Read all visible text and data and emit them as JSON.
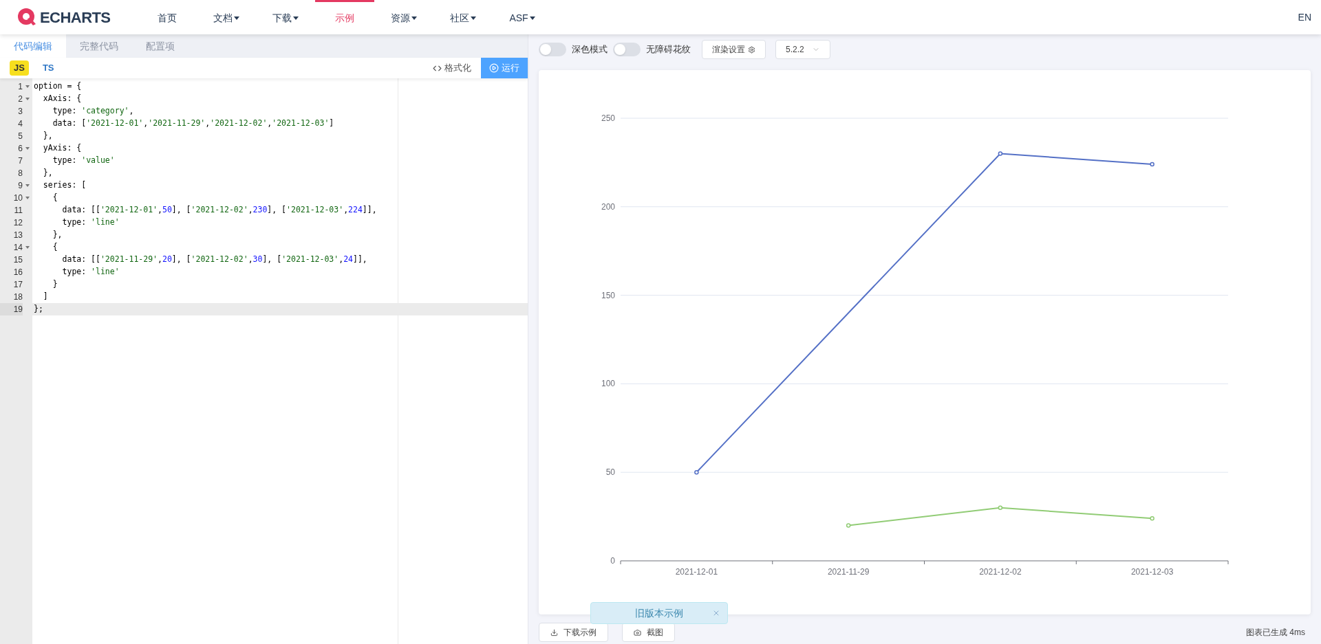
{
  "nav": {
    "logo": "ECHARTS",
    "items": [
      {
        "label": "首页",
        "dropdown": false,
        "selected": false
      },
      {
        "label": "文档",
        "dropdown": true,
        "selected": false
      },
      {
        "label": "下载",
        "dropdown": true,
        "selected": false
      },
      {
        "label": "示例",
        "dropdown": false,
        "selected": true
      },
      {
        "label": "资源",
        "dropdown": true,
        "selected": false
      },
      {
        "label": "社区",
        "dropdown": true,
        "selected": false
      },
      {
        "label": "ASF",
        "dropdown": true,
        "selected": false
      }
    ],
    "language": "EN"
  },
  "editor": {
    "tabs": [
      {
        "label": "代码编辑",
        "selected": true
      },
      {
        "label": "完整代码",
        "selected": false
      },
      {
        "label": "配置项",
        "selected": false
      }
    ],
    "languages": [
      {
        "label": "JS",
        "selected": true
      },
      {
        "label": "TS",
        "selected": false
      }
    ],
    "format_button": "格式化",
    "run_button": "运行",
    "lines": [
      {
        "number": "1",
        "fold": true,
        "current": false,
        "tokens": [
          {
            "kind": "plain",
            "text": "option = {"
          }
        ]
      },
      {
        "number": "2",
        "fold": true,
        "current": false,
        "tokens": [
          {
            "kind": "plain",
            "text": "  xAxis: {"
          }
        ]
      },
      {
        "number": "3",
        "fold": false,
        "current": false,
        "tokens": [
          {
            "kind": "plain",
            "text": "    type: "
          },
          {
            "kind": "string",
            "text": "'category'"
          },
          {
            "kind": "plain",
            "text": ","
          }
        ]
      },
      {
        "number": "4",
        "fold": false,
        "current": false,
        "tokens": [
          {
            "kind": "plain",
            "text": "    data: ["
          },
          {
            "kind": "string",
            "text": "'2021-12-01'"
          },
          {
            "kind": "plain",
            "text": ","
          },
          {
            "kind": "string",
            "text": "'2021-11-29'"
          },
          {
            "kind": "plain",
            "text": ","
          },
          {
            "kind": "string",
            "text": "'2021-12-02'"
          },
          {
            "kind": "plain",
            "text": ","
          },
          {
            "kind": "string",
            "text": "'2021-12-03'"
          },
          {
            "kind": "plain",
            "text": "]"
          }
        ]
      },
      {
        "number": "5",
        "fold": false,
        "current": false,
        "tokens": [
          {
            "kind": "plain",
            "text": "  },"
          }
        ]
      },
      {
        "number": "6",
        "fold": true,
        "current": false,
        "tokens": [
          {
            "kind": "plain",
            "text": "  yAxis: {"
          }
        ]
      },
      {
        "number": "7",
        "fold": false,
        "current": false,
        "tokens": [
          {
            "kind": "plain",
            "text": "    type: "
          },
          {
            "kind": "string",
            "text": "'value'"
          }
        ]
      },
      {
        "number": "8",
        "fold": false,
        "current": false,
        "tokens": [
          {
            "kind": "plain",
            "text": "  },"
          }
        ]
      },
      {
        "number": "9",
        "fold": true,
        "current": false,
        "tokens": [
          {
            "kind": "plain",
            "text": "  series: ["
          }
        ]
      },
      {
        "number": "10",
        "fold": true,
        "current": false,
        "tokens": [
          {
            "kind": "plain",
            "text": "    {"
          }
        ]
      },
      {
        "number": "11",
        "fold": false,
        "current": false,
        "tokens": [
          {
            "kind": "plain",
            "text": "      data: [["
          },
          {
            "kind": "string",
            "text": "'2021-12-01'"
          },
          {
            "kind": "plain",
            "text": ","
          },
          {
            "kind": "number",
            "text": "50"
          },
          {
            "kind": "plain",
            "text": "], ["
          },
          {
            "kind": "string",
            "text": "'2021-12-02'"
          },
          {
            "kind": "plain",
            "text": ","
          },
          {
            "kind": "number",
            "text": "230"
          },
          {
            "kind": "plain",
            "text": "], ["
          },
          {
            "kind": "string",
            "text": "'2021-12-03'"
          },
          {
            "kind": "plain",
            "text": ","
          },
          {
            "kind": "number",
            "text": "224"
          },
          {
            "kind": "plain",
            "text": "]],"
          }
        ]
      },
      {
        "number": "12",
        "fold": false,
        "current": false,
        "tokens": [
          {
            "kind": "plain",
            "text": "      type: "
          },
          {
            "kind": "string",
            "text": "'line'"
          }
        ]
      },
      {
        "number": "13",
        "fold": false,
        "current": false,
        "tokens": [
          {
            "kind": "plain",
            "text": "    },"
          }
        ]
      },
      {
        "number": "14",
        "fold": true,
        "current": false,
        "tokens": [
          {
            "kind": "plain",
            "text": "    {"
          }
        ]
      },
      {
        "number": "15",
        "fold": false,
        "current": false,
        "tokens": [
          {
            "kind": "plain",
            "text": "      data: [["
          },
          {
            "kind": "string",
            "text": "'2021-11-29'"
          },
          {
            "kind": "plain",
            "text": ","
          },
          {
            "kind": "number",
            "text": "20"
          },
          {
            "kind": "plain",
            "text": "], ["
          },
          {
            "kind": "string",
            "text": "'2021-12-02'"
          },
          {
            "kind": "plain",
            "text": ","
          },
          {
            "kind": "number",
            "text": "30"
          },
          {
            "kind": "plain",
            "text": "], ["
          },
          {
            "kind": "string",
            "text": "'2021-12-03'"
          },
          {
            "kind": "plain",
            "text": ","
          },
          {
            "kind": "number",
            "text": "24"
          },
          {
            "kind": "plain",
            "text": "]],"
          }
        ]
      },
      {
        "number": "16",
        "fold": false,
        "current": false,
        "tokens": [
          {
            "kind": "plain",
            "text": "      type: "
          },
          {
            "kind": "string",
            "text": "'line'"
          }
        ]
      },
      {
        "number": "17",
        "fold": false,
        "current": false,
        "tokens": [
          {
            "kind": "plain",
            "text": "    }"
          }
        ]
      },
      {
        "number": "18",
        "fold": false,
        "current": false,
        "tokens": [
          {
            "kind": "plain",
            "text": "  ]"
          }
        ]
      },
      {
        "number": "19",
        "fold": false,
        "current": true,
        "tokens": [
          {
            "kind": "plain",
            "text": "};"
          }
        ]
      }
    ]
  },
  "preview": {
    "toggles": [
      {
        "label": "深色模式",
        "on": false
      },
      {
        "label": "无障碍花纹",
        "on": false
      }
    ],
    "render_settings": "渲染设置",
    "version": "5.2.2",
    "chart_data": {
      "type": "line",
      "categories": [
        "2021-12-01",
        "2021-11-29",
        "2021-12-02",
        "2021-12-03"
      ],
      "series": [
        {
          "color": "#5470c6",
          "marker": true,
          "values": [
            50,
            null,
            230,
            224
          ]
        },
        {
          "color": "#91cc75",
          "marker": true,
          "values": [
            null,
            20,
            30,
            24
          ]
        }
      ],
      "grid": true,
      "ylim": [
        0,
        250
      ],
      "yticks": [
        0,
        50,
        100,
        150,
        200,
        250
      ]
    },
    "download_button": "下载示例",
    "screenshot_button": "截图",
    "toast": "旧版本示例",
    "status": "图表已生成 4ms"
  }
}
